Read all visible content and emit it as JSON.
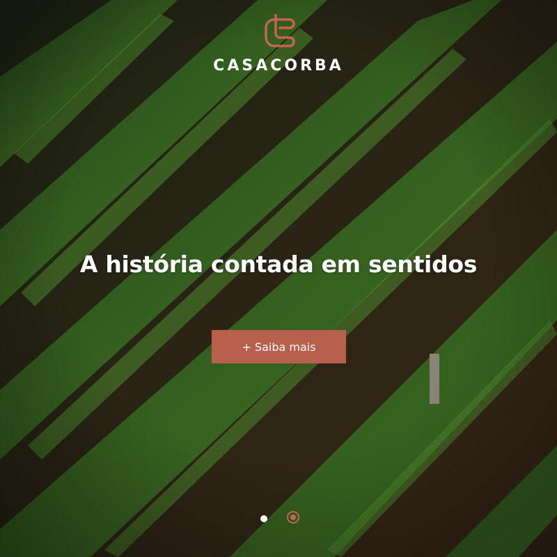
{
  "brand": {
    "name": "CASACORBA",
    "logo_icon": "casacorba-c-monogram",
    "accent_color": "#c5654e"
  },
  "hero": {
    "background": "vineyard-rows-photo",
    "headline": "A história contada em sentidos",
    "cta_label": "+ Saiba mais",
    "cta_color": "#b8604c"
  },
  "carousel": {
    "slide_count": 2,
    "active_slide": 2
  }
}
